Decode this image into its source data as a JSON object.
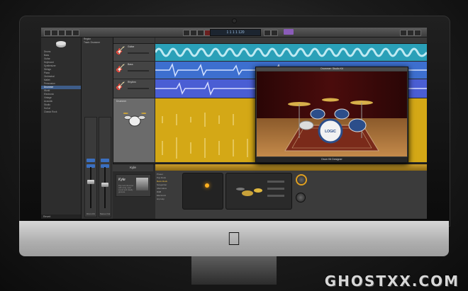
{
  "app": {
    "toolbar": {
      "lcd_text": "1 1 1 1   120"
    },
    "library": {
      "header": "Library",
      "items": [
        "Drums",
        "Bass",
        "Guitar",
        "Keyboard",
        "Synthesizer",
        "Strings",
        "Piano",
        "Orchestral",
        "Mallet",
        "Percussion",
        "Drummer",
        "World",
        "Electronic",
        "Vintage",
        "Acoustic",
        "Studio",
        "SoCal",
        "Classic Rock"
      ],
      "selected_index": 10,
      "footer": "Revert"
    },
    "inspector": {
      "rows": [
        "Region",
        "Track: Drummer"
      ],
      "strip_left_label": "Drum Kit",
      "strip_right_label": "Stereo Out",
      "bottom_left": "Drummer",
      "bottom_right": "Output"
    },
    "tracks": [
      {
        "name": "Guitar",
        "icon": "guitar-icon",
        "color": "#2aa0b8"
      },
      {
        "name": "Bass",
        "icon": "guitar-icon",
        "color": "#3d6fcf"
      },
      {
        "name": "Rhythm",
        "icon": "guitar-icon",
        "color": "#4a5ed4"
      },
      {
        "name": "Drummer",
        "icon": "drum-icon",
        "color": "#d4a816"
      }
    ],
    "smart_controls": {
      "tab": "Kyle",
      "drummer_name": "Kyle",
      "drummer_desc": "Pop rock drummer with a big, open sound and steady grooves.",
      "presets": [
        "Preset",
        "Pop Rock",
        "Retro Rock",
        "Songwriter",
        "Alternative",
        "R&B",
        "Electronic",
        "Hip Hop"
      ],
      "selected_preset_index": 2
    },
    "plugin_window": {
      "title": "Drummer: Studio Kit",
      "footer": "Drum Kit Designer"
    },
    "colors": {
      "accent_gold": "#d4a816",
      "region_teal": "#2aa0b8",
      "region_blue": "#3d6fcf",
      "region_indigo": "#4a5ed4",
      "selection_blue": "#3e5d8a"
    }
  },
  "watermark": "GHOSTXX.COM"
}
